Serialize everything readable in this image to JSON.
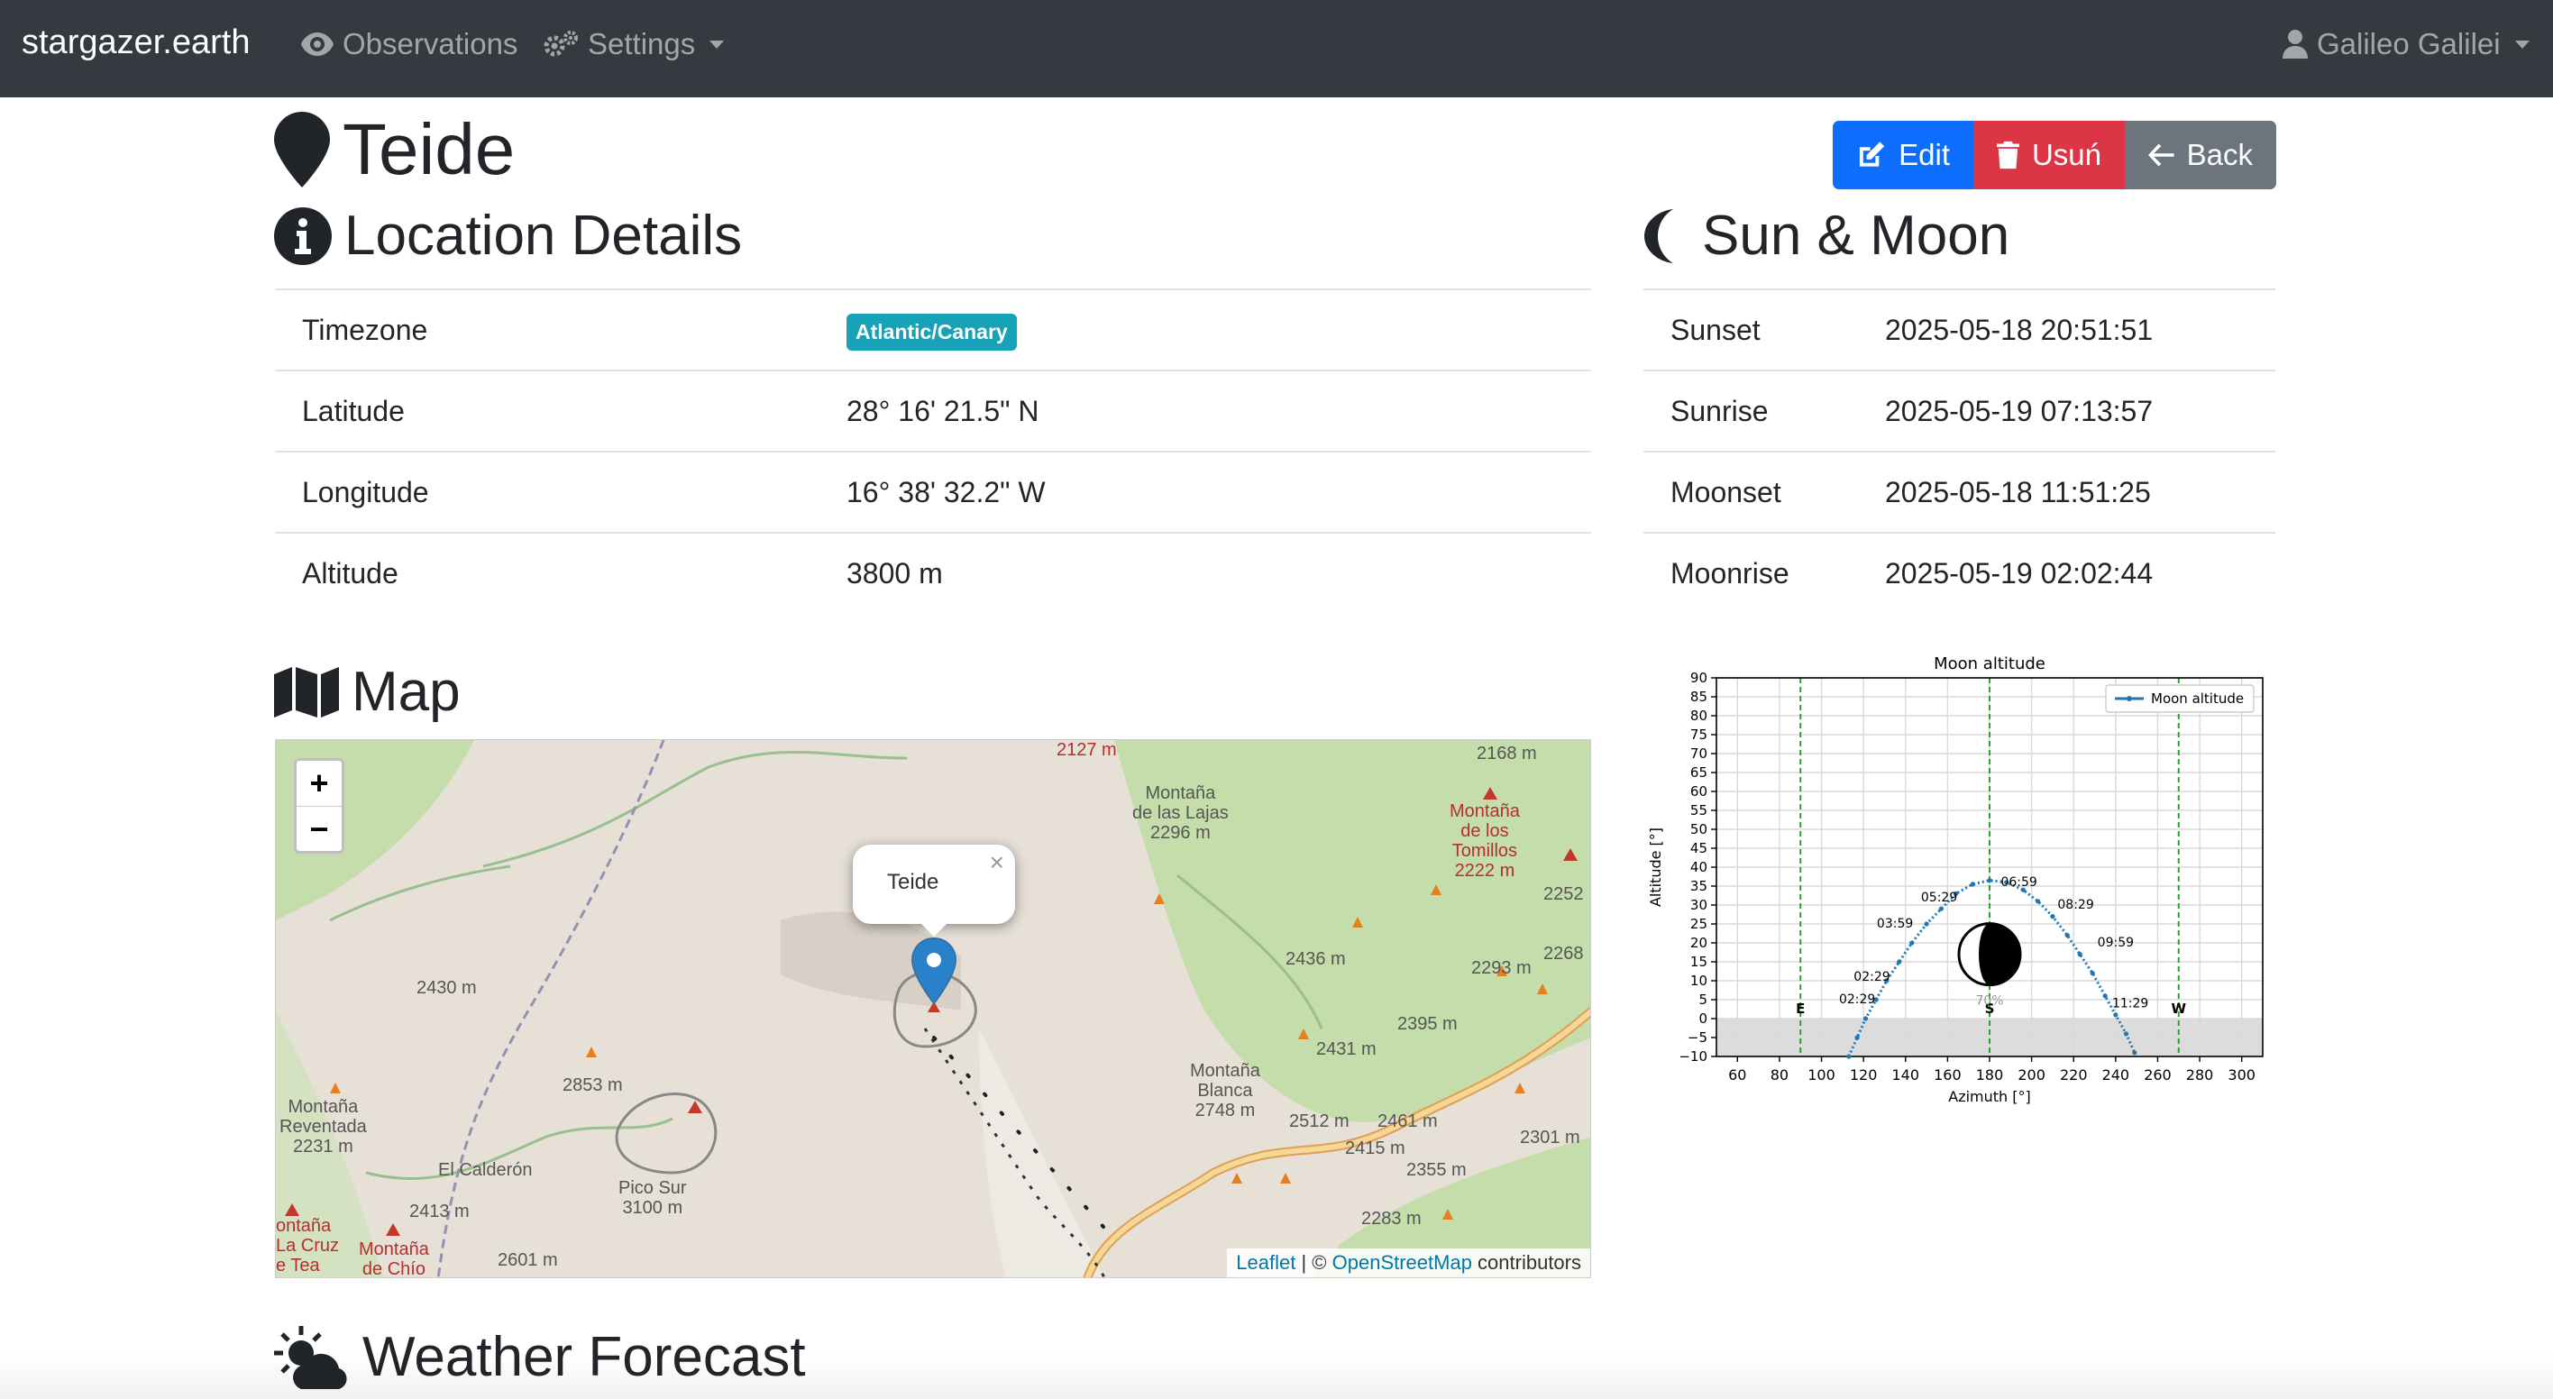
{
  "navbar": {
    "brand": "stargazer.earth",
    "observations": "Observations",
    "settings": "Settings",
    "user": "Galileo Galilei"
  },
  "page": {
    "title": "Teide",
    "buttons": {
      "edit": "Edit",
      "delete": "Usuń",
      "back": "Back"
    }
  },
  "location": {
    "heading": "Location Details",
    "rows": [
      {
        "key": "Timezone",
        "value": "Atlantic/Canary"
      },
      {
        "key": "Latitude",
        "value": "28° 16' 21.5\" N"
      },
      {
        "key": "Longitude",
        "value": "16° 38' 32.2\" W"
      },
      {
        "key": "Altitude",
        "value": "3800 m"
      }
    ]
  },
  "sun_moon": {
    "heading": "Sun & Moon",
    "rows": [
      {
        "key": "Sunset",
        "value": "2025-05-18 20:51:51"
      },
      {
        "key": "Sunrise",
        "value": "2025-05-19 07:13:57"
      },
      {
        "key": "Moonset",
        "value": "2025-05-18 11:51:25"
      },
      {
        "key": "Moonrise",
        "value": "2025-05-19 02:02:44"
      }
    ]
  },
  "map": {
    "heading": "Map",
    "zoom_in": "+",
    "zoom_out": "−",
    "popup": "Teide",
    "popup_close": "×",
    "attribution_leaflet": "Leaflet",
    "attribution_sep": " | © ",
    "attribution_osm": "OpenStreetMap",
    "attribution_rest": " contributors",
    "labels": [
      "2127 m",
      "2168 m",
      "Montaña",
      "de las Lajas",
      "2296 m",
      "Montaña",
      "de los",
      "Tomillos",
      "2222 m",
      "2252",
      "2268",
      "2430 m",
      "2436 m",
      "2293 m",
      "2395 m",
      "2431 m",
      "2853 m",
      "Montaña",
      "Blanca",
      "2748 m",
      "2512 m",
      "2461 m",
      "2415 m",
      "2355 m",
      "2301 m",
      "Montaña",
      "Reventada",
      "2231 m",
      "El Calderón",
      "Pico Sur",
      "3100 m",
      "2413 m",
      "Montaña",
      "de Chío",
      "2601 m",
      "2283 m",
      "ontaña",
      "La Cruz",
      "e Tea"
    ]
  },
  "weather": {
    "heading": "Weather Forecast"
  },
  "chart_data": {
    "type": "line",
    "title": "Moon altitude",
    "xlabel": "Azimuth [°]",
    "ylabel": "Altitude [°]",
    "xlim": [
      50,
      310
    ],
    "ylim": [
      -10,
      90
    ],
    "xticks": [
      60,
      80,
      100,
      120,
      140,
      160,
      180,
      200,
      220,
      240,
      260,
      280,
      300
    ],
    "yticks": [
      -10,
      -5,
      0,
      5,
      10,
      15,
      20,
      25,
      30,
      35,
      40,
      45,
      50,
      55,
      60,
      65,
      70,
      75,
      80,
      85,
      90
    ],
    "grid": true,
    "legend": "top-right",
    "series": [
      {
        "name": "Moon altitude",
        "x": [
          113,
          117,
          121,
          126,
          131,
          137,
          143,
          150,
          157,
          164,
          172,
          180,
          188,
          196,
          203,
          210,
          217,
          223,
          229,
          235,
          240,
          245,
          249
        ],
        "y": [
          -10,
          -5,
          0,
          5,
          10,
          15,
          20,
          25,
          29,
          33,
          35.5,
          36.5,
          36,
          34,
          31,
          27,
          22,
          17,
          12,
          6,
          1,
          -4,
          -9
        ]
      }
    ],
    "time_labels": [
      {
        "label": "02:29",
        "x": 117,
        "y": 4
      },
      {
        "label": "02:29",
        "x": 124,
        "y": 10
      },
      {
        "label": "03:59",
        "x": 135,
        "y": 24
      },
      {
        "label": "05:29",
        "x": 156,
        "y": 31
      },
      {
        "label": "06:59",
        "x": 194,
        "y": 35
      },
      {
        "label": "08:29",
        "x": 221,
        "y": 29
      },
      {
        "label": "09:59",
        "x": 240,
        "y": 19
      },
      {
        "label": "11:29",
        "x": 247,
        "y": 3
      }
    ],
    "directions": [
      {
        "label": "E",
        "x": 90
      },
      {
        "label": "S",
        "x": 180
      },
      {
        "label": "W",
        "x": 270
      }
    ],
    "moon_phase_label": "70%",
    "moon_phase_position": {
      "x": 180,
      "y": 17
    },
    "below_horizon_shaded": true,
    "colors": {
      "line": "#1f77b4",
      "vertical_lines": "#2ca02c",
      "below_horizon": "#dcdcdc"
    }
  }
}
